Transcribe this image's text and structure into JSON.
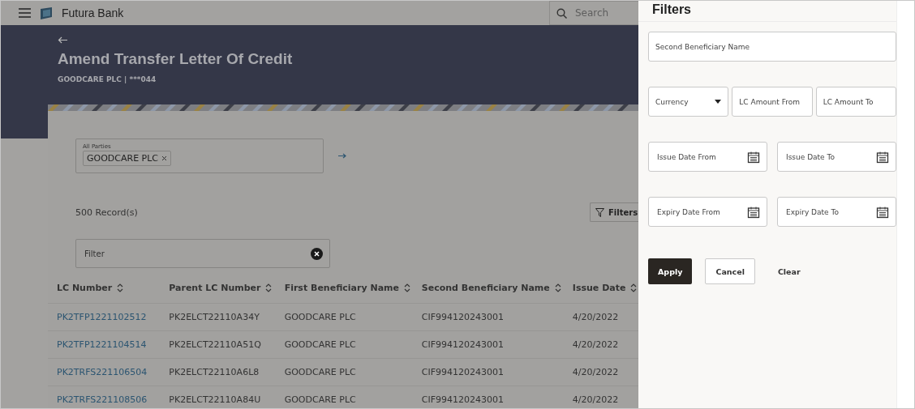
{
  "header": {
    "brand": "Futura Bank",
    "search": {
      "placeholder": "Search"
    }
  },
  "page": {
    "title": "Amend Transfer Letter Of Credit",
    "subtitle": "GOODCARE PLC | ***044"
  },
  "party_field": {
    "label": "All Parties",
    "chips": [
      {
        "label": "GOODCARE PLC"
      }
    ]
  },
  "records": "500 Record(s)",
  "filters_button": "Filters",
  "filter_field": {
    "placeholder": "Filter"
  },
  "table": {
    "columns": [
      "LC Number",
      "Parent LC Number",
      "First Beneficiary Name",
      "Second Beneficiary Name",
      "Issue Date"
    ],
    "rows": [
      [
        "PK2TFP1221102512",
        "PK2ELCT22110A34Y",
        "GOODCARE PLC",
        "CIF994120243001",
        "4/20/2022"
      ],
      [
        "PK2TFP1221104514",
        "PK2ELCT22110A51Q",
        "GOODCARE PLC",
        "CIF994120243001",
        "4/20/2022"
      ],
      [
        "PK2TRFS221106504",
        "PK2ELCT22110A6L8",
        "GOODCARE PLC",
        "CIF994120243001",
        "4/20/2022"
      ],
      [
        "PK2TRFS221108506",
        "PK2ELCT22110A84U",
        "GOODCARE PLC",
        "CIF994120243001",
        "4/20/2022"
      ]
    ]
  },
  "filters_panel": {
    "title": "Filters",
    "rows": [
      [
        {
          "kind": "text",
          "placeholder": "Second Beneficiary Name"
        }
      ],
      [
        {
          "kind": "select",
          "label": "Currency"
        },
        {
          "kind": "text",
          "placeholder": "LC Amount From"
        },
        {
          "kind": "text",
          "placeholder": "LC Amount To"
        }
      ],
      [
        {
          "kind": "date",
          "placeholder": "Issue Date From"
        },
        {
          "kind": "date",
          "placeholder": "Issue Date To"
        }
      ],
      [
        {
          "kind": "date",
          "placeholder": "Expiry Date From"
        },
        {
          "kind": "date",
          "placeholder": "Expiry Date To"
        }
      ]
    ],
    "buttons": [
      {
        "kind": "primary",
        "label": "Apply"
      },
      {
        "kind": "secondary",
        "label": "Cancel"
      },
      {
        "kind": "link",
        "label": "Clear"
      }
    ]
  }
}
